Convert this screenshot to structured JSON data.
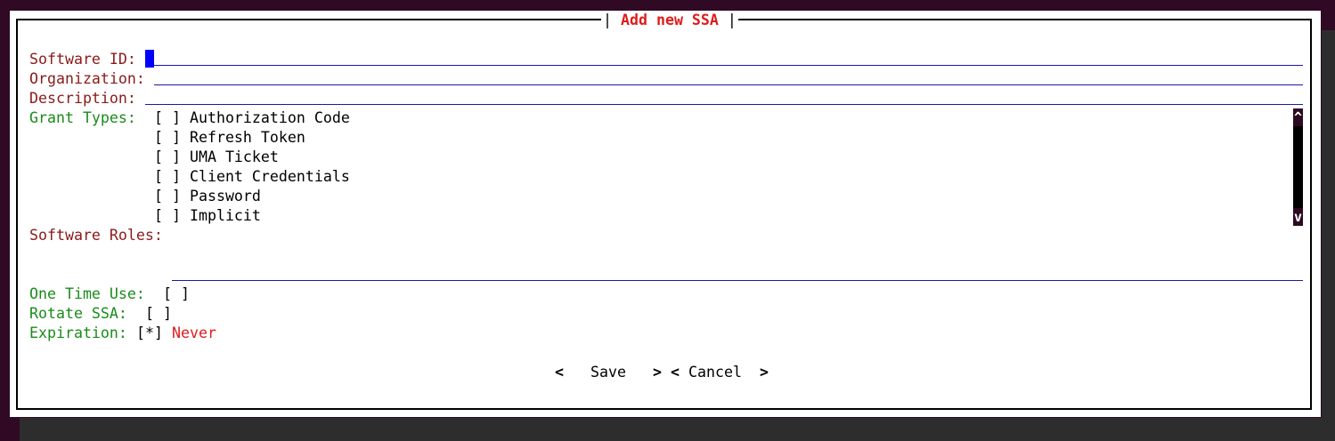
{
  "dialog": {
    "title": "Add new SSA",
    "title_left": "|",
    "title_right": "|"
  },
  "fields": {
    "software_id_label": "Software ID:",
    "organization_label": "Organization:",
    "description_label": "Description:",
    "grant_types_label": "Grant Types:",
    "software_roles_label": "Software Roles:",
    "one_time_use_label": "One Time Use:",
    "rotate_ssa_label": "Rotate SSA:",
    "expiration_label": "Expiration:"
  },
  "grant_types": [
    {
      "check": "[ ]",
      "label": "Authorization Code"
    },
    {
      "check": "[ ]",
      "label": "Refresh Token"
    },
    {
      "check": "[ ]",
      "label": "UMA Ticket"
    },
    {
      "check": "[ ]",
      "label": "Client Credentials"
    },
    {
      "check": "[ ]",
      "label": "Password"
    },
    {
      "check": "[ ]",
      "label": "Implicit"
    }
  ],
  "one_time_use_check": "[ ]",
  "rotate_ssa_check": "[ ]",
  "expiration_check": "[*]",
  "expiration_value": "Never",
  "scroll": {
    "up": "^",
    "down": "v"
  },
  "buttons": {
    "save_left": "<",
    "save_label": "Save",
    "save_right": ">",
    "cancel_left": "<",
    "cancel_label": "Cancel",
    "cancel_right": ">"
  },
  "colors": {
    "label_required": "#8b1a1a",
    "label_optional": "#1a8b1a",
    "accent_red": "#e01b1b",
    "field_underline": "#1a1aa6",
    "cursor": "#0000ff"
  }
}
